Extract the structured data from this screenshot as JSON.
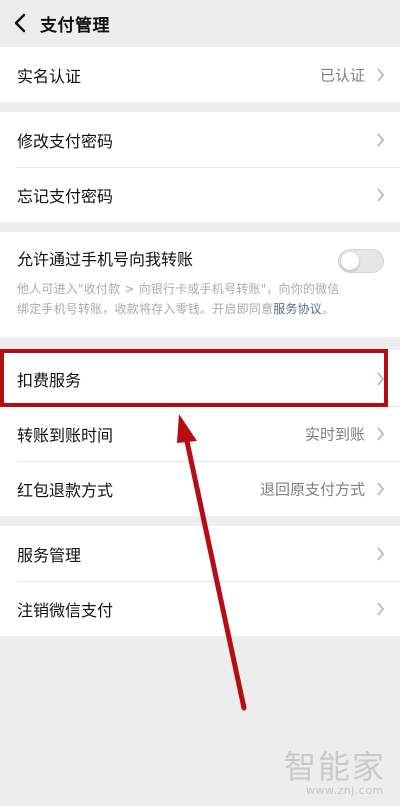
{
  "header": {
    "title": "支付管理",
    "back_icon": "chevron-left-icon"
  },
  "groups": [
    {
      "rows": [
        {
          "label": "实名认证",
          "value": "已认证"
        }
      ]
    },
    {
      "rows": [
        {
          "label": "修改支付密码"
        },
        {
          "label": "忘记支付密码"
        }
      ]
    },
    {
      "toggle_row": {
        "label": "允许通过手机号向我转账",
        "enabled": false,
        "description_line1": "他人可进入\"收付款 > 向银行卡或手机号转账\"，向你的微信",
        "description_line2": "绑定手机号转账，收款将存入零钱。开启即同意",
        "description_link": "服务协议",
        "description_end": "。"
      }
    },
    {
      "rows": [
        {
          "label": "扣费服务"
        },
        {
          "label": "转账到账时间",
          "value": "实时到账"
        },
        {
          "label": "红包退款方式",
          "value": "退回原支付方式"
        }
      ]
    },
    {
      "rows": [
        {
          "label": "服务管理"
        },
        {
          "label": "注销微信支付"
        }
      ]
    }
  ],
  "annotation": {
    "highlight_color": "#b40e12",
    "arrow_color": "#b40e12"
  },
  "watermark": {
    "text": "智能家",
    "url": "www.znj.com"
  },
  "colors": {
    "background": "#ededed",
    "text_primary": "#111111",
    "text_secondary": "#7f7f7f",
    "link": "#576b95"
  }
}
